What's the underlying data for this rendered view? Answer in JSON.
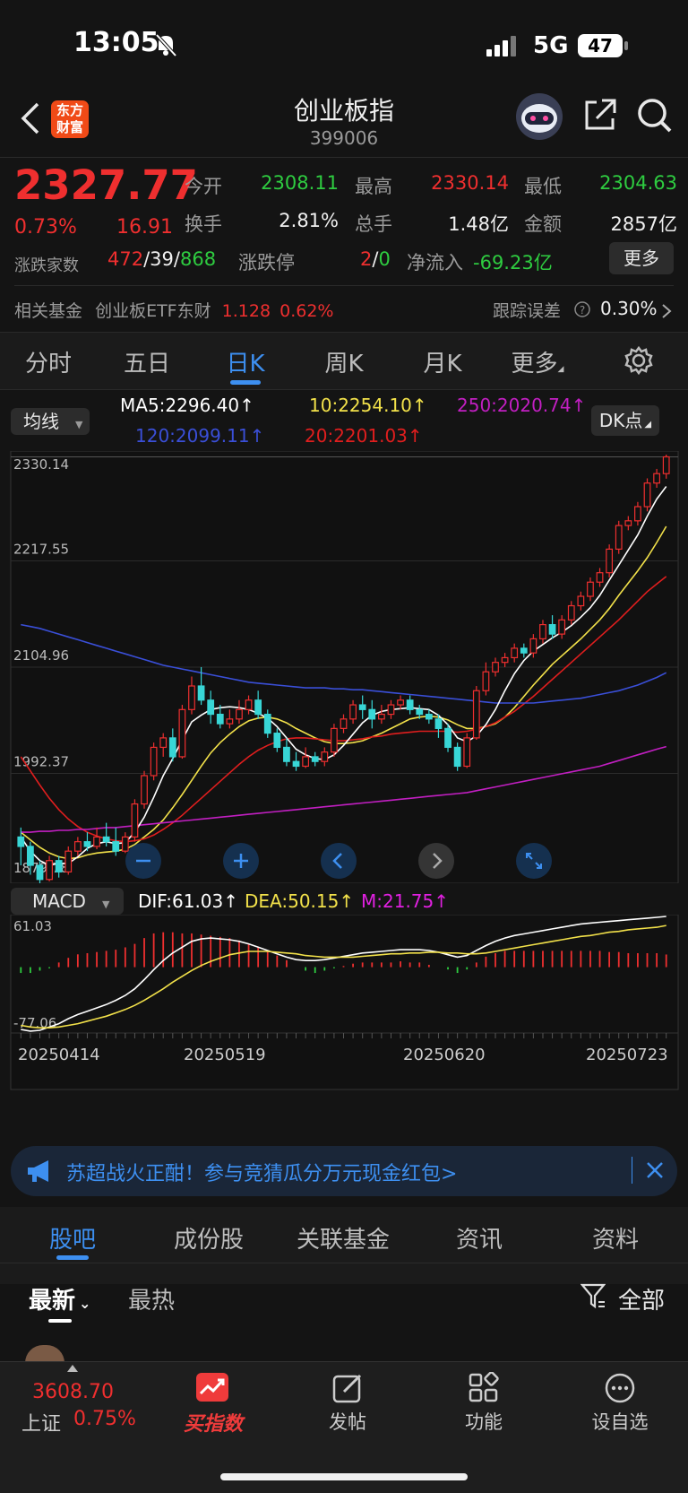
{
  "status_bar": {
    "time": "13:05",
    "network": "5G",
    "battery": "47"
  },
  "header": {
    "title": "创业板指",
    "code": "399006",
    "logo_line1": "东方",
    "logo_line2": "财富"
  },
  "quote": {
    "price": "2327.77",
    "change_pct": "0.73%",
    "change_abs": "16.91",
    "open_label": "今开",
    "open": "2308.11",
    "high_label": "最高",
    "high": "2330.14",
    "low_label": "最低",
    "low": "2304.63",
    "turnover_label": "换手",
    "turnover": "2.81%",
    "volume_label": "总手",
    "volume": "1.48亿",
    "amount_label": "金额",
    "amount": "2857亿",
    "breadth_label": "涨跌家数",
    "up": "472",
    "flat": "39",
    "down": "868",
    "limit_label": "涨跌停",
    "limit_up": "2",
    "limit_down": "0",
    "netflow_label": "净流入",
    "netflow": "-69.23亿",
    "more_label": "更多"
  },
  "fund": {
    "label": "相关基金",
    "name": "创业板ETF东财",
    "price": "1.128",
    "pct": "0.62%",
    "tracking_label": "跟踪误差",
    "tracking": "0.30%"
  },
  "period_tabs": [
    "分时",
    "五日",
    "日K",
    "周K",
    "月K",
    "更多"
  ],
  "active_period": 2,
  "ma_bar": {
    "selector": "均线",
    "ma5": "MA5:2296.40↑",
    "ma10": "10:2254.10↑",
    "ma250": "250:2020.74↑",
    "ma120": "120:2099.11↑",
    "ma20": "20:2201.03↑",
    "dk": "DK点"
  },
  "macd_bar": {
    "selector": "MACD",
    "dif": "DIF:61.03↑",
    "dea": "DEA:50.15↑",
    "m": "M:21.75↑"
  },
  "colors": {
    "up": "#ef2f2f",
    "down": "#38d6d6",
    "ma5": "#ffffff",
    "ma10": "#f2e14a",
    "ma20": "#e01e1e",
    "ma120": "#3a4fd8",
    "ma250": "#c21fc2",
    "accent": "#3d8ff0"
  },
  "chart_data": [
    {
      "type": "candlestick",
      "title": "",
      "y_ticks": [
        "2330.14",
        "2217.55",
        "2104.96",
        "1992.37",
        "1879.78"
      ],
      "ylim": [
        1879.78,
        2330.14
      ],
      "x_ticks": [
        "20250414",
        "20250519",
        "20250620",
        "20250723"
      ],
      "last_close": 2327.77,
      "series_lines": [
        {
          "name": "MA5",
          "last": 2296.4
        },
        {
          "name": "10",
          "last": 2254.1
        },
        {
          "name": "20",
          "last": 2201.03
        },
        {
          "name": "120",
          "last": 2099.11
        },
        {
          "name": "250",
          "last": 2020.74
        }
      ],
      "candles": [
        [
          1925,
          1915,
          1935,
          1895
        ],
        [
          1915,
          1895,
          1920,
          1885
        ],
        [
          1895,
          1880,
          1900,
          1875
        ],
        [
          1880,
          1900,
          1905,
          1878
        ],
        [
          1900,
          1888,
          1905,
          1882
        ],
        [
          1888,
          1910,
          1915,
          1885
        ],
        [
          1910,
          1920,
          1925,
          1905
        ],
        [
          1920,
          1915,
          1930,
          1910
        ],
        [
          1915,
          1925,
          1935,
          1912
        ],
        [
          1925,
          1920,
          1940,
          1915
        ],
        [
          1920,
          1910,
          1935,
          1905
        ],
        [
          1910,
          1925,
          1930,
          1908
        ],
        [
          1925,
          1960,
          1965,
          1920
        ],
        [
          1960,
          1990,
          1995,
          1955
        ],
        [
          1990,
          2020,
          2025,
          1985
        ],
        [
          2020,
          2030,
          2035,
          2010
        ],
        [
          2030,
          2010,
          2040,
          2005
        ],
        [
          2010,
          2060,
          2065,
          2008
        ],
        [
          2060,
          2085,
          2095,
          2055
        ],
        [
          2085,
          2070,
          2105,
          2065
        ],
        [
          2070,
          2055,
          2080,
          2045
        ],
        [
          2055,
          2045,
          2065,
          2040
        ],
        [
          2045,
          2050,
          2060,
          2040
        ],
        [
          2050,
          2060,
          2070,
          2045
        ],
        [
          2060,
          2070,
          2075,
          2055
        ],
        [
          2070,
          2055,
          2080,
          2050
        ],
        [
          2055,
          2035,
          2060,
          2030
        ],
        [
          2035,
          2020,
          2040,
          2015
        ],
        [
          2020,
          2005,
          2030,
          2000
        ],
        [
          2005,
          2000,
          2015,
          1995
        ],
        [
          2000,
          2010,
          2020,
          1998
        ],
        [
          2010,
          2005,
          2015,
          2000
        ],
        [
          2005,
          2015,
          2020,
          2000
        ],
        [
          2015,
          2040,
          2045,
          2010
        ],
        [
          2040,
          2050,
          2055,
          2035
        ],
        [
          2050,
          2065,
          2070,
          2045
        ],
        [
          2065,
          2060,
          2075,
          2050
        ],
        [
          2060,
          2050,
          2070,
          2040
        ],
        [
          2050,
          2055,
          2065,
          2045
        ],
        [
          2055,
          2065,
          2070,
          2050
        ],
        [
          2065,
          2070,
          2075,
          2060
        ],
        [
          2070,
          2060,
          2075,
          2055
        ],
        [
          2060,
          2055,
          2065,
          2050
        ],
        [
          2055,
          2050,
          2060,
          2045
        ],
        [
          2050,
          2040,
          2055,
          2030
        ],
        [
          2040,
          2020,
          2045,
          2015
        ],
        [
          2020,
          2000,
          2025,
          1995
        ],
        [
          2000,
          2030,
          2035,
          1998
        ],
        [
          2030,
          2080,
          2085,
          2028
        ],
        [
          2080,
          2100,
          2110,
          2075
        ],
        [
          2100,
          2110,
          2115,
          2095
        ],
        [
          2110,
          2115,
          2120,
          2105
        ],
        [
          2115,
          2125,
          2130,
          2110
        ],
        [
          2125,
          2120,
          2130,
          2115
        ],
        [
          2120,
          2135,
          2140,
          2115
        ],
        [
          2135,
          2150,
          2155,
          2130
        ],
        [
          2150,
          2140,
          2160,
          2135
        ],
        [
          2140,
          2155,
          2160,
          2135
        ],
        [
          2155,
          2170,
          2175,
          2150
        ],
        [
          2170,
          2180,
          2185,
          2165
        ],
        [
          2180,
          2195,
          2200,
          2175
        ],
        [
          2195,
          2205,
          2210,
          2190
        ],
        [
          2205,
          2230,
          2235,
          2200
        ],
        [
          2230,
          2255,
          2260,
          2225
        ],
        [
          2255,
          2260,
          2265,
          2250
        ],
        [
          2260,
          2275,
          2280,
          2255
        ],
        [
          2275,
          2300,
          2305,
          2270
        ],
        [
          2300,
          2310,
          2315,
          2295
        ],
        [
          2310,
          2327.77,
          2330.14,
          2304.63
        ]
      ],
      "ma_series": {
        "MA5": [
          1925,
          1910,
          1900,
          1895,
          1897,
          1897,
          1904,
          1913,
          1918,
          1920,
          1918,
          1919,
          1930,
          1946,
          1967,
          1990,
          2008,
          2028,
          2047,
          2054,
          2060,
          2062,
          2063,
          2062,
          2060,
          2056,
          2051,
          2042,
          2030,
          2018,
          2012,
          2008,
          2007,
          2012,
          2022,
          2034,
          2046,
          2054,
          2058,
          2060,
          2061,
          2062,
          2061,
          2060,
          2054,
          2044,
          2030,
          2026,
          2032,
          2044,
          2060,
          2080,
          2098,
          2112,
          2122,
          2129,
          2136,
          2142,
          2149,
          2158,
          2168,
          2181,
          2197,
          2213,
          2229,
          2245,
          2265,
          2283,
          2296.4
        ],
        "10": [
          1930,
          1922,
          1914,
          1908,
          1904,
          1902,
          1903,
          1906,
          1908,
          1909,
          1910,
          1912,
          1917,
          1925,
          1933,
          1943,
          1956,
          1970,
          1985,
          2000,
          2014,
          2025,
          2034,
          2042,
          2048,
          2051,
          2052,
          2050,
          2046,
          2040,
          2035,
          2030,
          2026,
          2024,
          2024,
          2025,
          2027,
          2031,
          2035,
          2040,
          2045,
          2050,
          2052,
          2053,
          2052,
          2049,
          2044,
          2040,
          2040,
          2042,
          2045,
          2052,
          2062,
          2074,
          2086,
          2097,
          2108,
          2117,
          2126,
          2135,
          2145,
          2155,
          2167,
          2181,
          2194,
          2207,
          2221,
          2237,
          2254.1
        ],
        "20": [
          2010,
          1995,
          1980,
          1966,
          1954,
          1944,
          1936,
          1930,
          1926,
          1923,
          1921,
          1920,
          1921,
          1923,
          1927,
          1933,
          1940,
          1948,
          1957,
          1966,
          1975,
          1984,
          1993,
          2002,
          2010,
          2017,
          2022,
          2026,
          2029,
          2030,
          2030,
          2029,
          2028,
          2027,
          2027,
          2028,
          2029,
          2031,
          2032,
          2034,
          2035,
          2036,
          2037,
          2037,
          2037,
          2037,
          2036,
          2037,
          2039,
          2042,
          2046,
          2052,
          2058,
          2066,
          2074,
          2083,
          2092,
          2101,
          2110,
          2119,
          2128,
          2137,
          2146,
          2155,
          2165,
          2175,
          2185,
          2193,
          2201.03
        ],
        "120": [
          2150,
          2148,
          2146,
          2143,
          2140,
          2137,
          2134,
          2131,
          2128,
          2125,
          2122,
          2119,
          2116,
          2113,
          2110,
          2107,
          2105,
          2103,
          2101,
          2099,
          2097,
          2095,
          2093,
          2091,
          2089,
          2088,
          2087,
          2086,
          2085,
          2084,
          2083,
          2083,
          2083,
          2082,
          2082,
          2081,
          2081,
          2080,
          2079,
          2078,
          2077,
          2076,
          2075,
          2074,
          2073,
          2072,
          2071,
          2070,
          2069,
          2068,
          2067,
          2067,
          2067,
          2067,
          2067,
          2068,
          2069,
          2070,
          2071,
          2072,
          2074,
          2076,
          2078,
          2080,
          2083,
          2086,
          2090,
          2094,
          2099.11
        ],
        "250": [
          1930,
          1930,
          1931,
          1931,
          1932,
          1932,
          1933,
          1933,
          1934,
          1935,
          1935,
          1936,
          1937,
          1938,
          1939,
          1940,
          1941,
          1942,
          1943,
          1944,
          1945,
          1946,
          1947,
          1948,
          1949,
          1950,
          1951,
          1952,
          1953,
          1954,
          1955,
          1956,
          1957,
          1958,
          1959,
          1960,
          1961,
          1962,
          1963,
          1964,
          1965,
          1966,
          1967,
          1968,
          1969,
          1970,
          1971,
          1972,
          1974,
          1976,
          1978,
          1980,
          1982,
          1984,
          1986,
          1988,
          1990,
          1992,
          1994,
          1996,
          1998,
          2000,
          2003,
          2006,
          2009,
          2012,
          2015,
          2018,
          2020.74
        ]
      }
    },
    {
      "type": "bar",
      "title": "",
      "y_ticks": [
        "61.03",
        "-77.06"
      ],
      "ylim": [
        -77.06,
        61.03
      ],
      "series": [
        {
          "name": "DIF",
          "values": [
            -75,
            -77,
            -76,
            -72,
            -68,
            -62,
            -57,
            -53,
            -49,
            -45,
            -40,
            -34,
            -26,
            -15,
            -3,
            8,
            17,
            24,
            31,
            34,
            35,
            34,
            33,
            31,
            28,
            24,
            20,
            16,
            12,
            9,
            8,
            8,
            9,
            11,
            13,
            15,
            17,
            18,
            19,
            20,
            21,
            21,
            21,
            20,
            18,
            15,
            12,
            14,
            20,
            26,
            31,
            35,
            38,
            40,
            42,
            44,
            46,
            48,
            50,
            52,
            53,
            54,
            55,
            56,
            57,
            58,
            59,
            60,
            61.03
          ]
        },
        {
          "name": "DEA",
          "values": [
            -70,
            -72,
            -73,
            -73,
            -72,
            -70,
            -68,
            -65,
            -62,
            -59,
            -55,
            -51,
            -46,
            -40,
            -33,
            -26,
            -18,
            -11,
            -4,
            2,
            7,
            11,
            15,
            17,
            19,
            19,
            19,
            18,
            17,
            16,
            14,
            13,
            12,
            12,
            12,
            12,
            13,
            14,
            15,
            16,
            16,
            17,
            17,
            18,
            18,
            17,
            17,
            16,
            16,
            17,
            19,
            21,
            23,
            25,
            27,
            29,
            31,
            33,
            35,
            37,
            38,
            40,
            42,
            43,
            45,
            46,
            47,
            48,
            50.15
          ]
        },
        {
          "name": "M",
          "values": [
            -10,
            -10,
            -6,
            -2,
            8,
            16,
            22,
            24,
            26,
            28,
            30,
            34,
            40,
            50,
            58,
            60,
            60,
            58,
            58,
            56,
            54,
            52,
            50,
            46,
            40,
            34,
            28,
            20,
            12,
            0,
            -6,
            -10,
            -6,
            -2,
            2,
            6,
            8,
            8,
            8,
            8,
            10,
            8,
            8,
            4,
            0,
            -4,
            -10,
            -4,
            8,
            18,
            24,
            28,
            28,
            28,
            28,
            28,
            28,
            28,
            28,
            28,
            28,
            28,
            26,
            26,
            24,
            24,
            24,
            24,
            21.75
          ]
        }
      ]
    }
  ],
  "chart_buttons": [
    "zoom-out",
    "zoom-in",
    "prev",
    "next",
    "fullscreen"
  ],
  "banner": {
    "text": "苏超战火正酣！参与竞猜瓜分万元现金红包>"
  },
  "content_tabs": [
    "股吧",
    "成份股",
    "关联基金",
    "资讯",
    "资料"
  ],
  "active_content_tab": 0,
  "sort": {
    "newest": "最新",
    "hottest": "最热",
    "filter": "全部"
  },
  "bottom_bar": {
    "index_value": "3608.70",
    "index_name": "上证",
    "index_pct": "0.75%",
    "buy_label": "买指数",
    "post_label": "发帖",
    "func_label": "功能",
    "watch_label": "设自选"
  }
}
